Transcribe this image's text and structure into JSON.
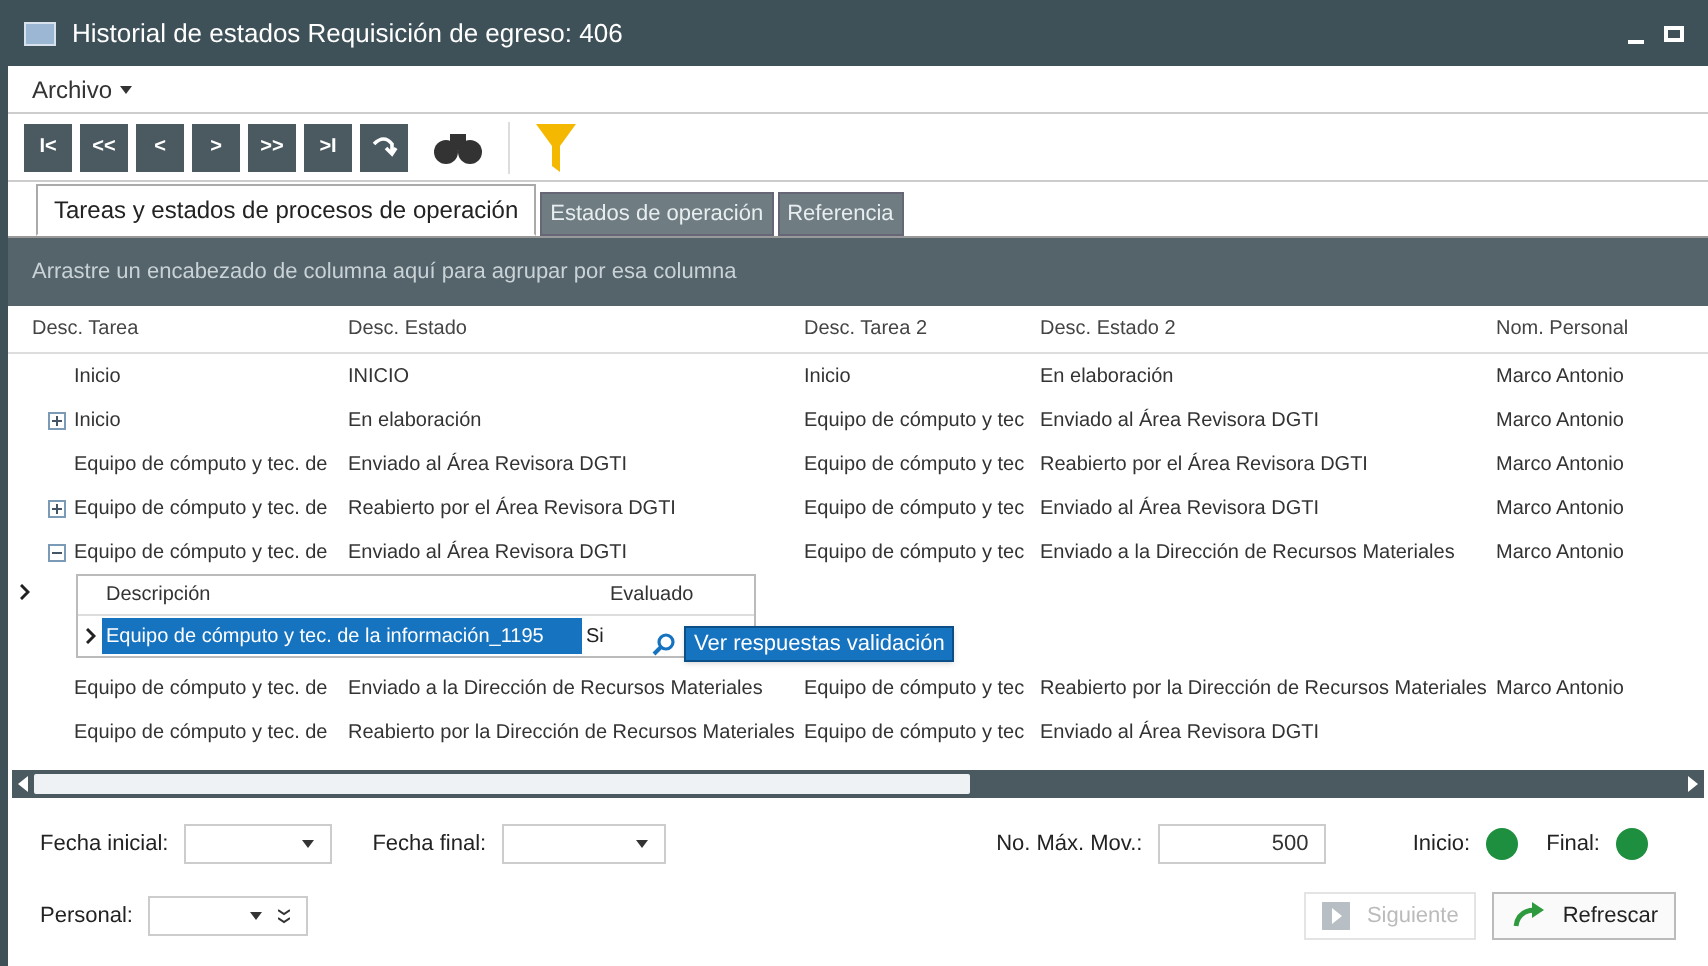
{
  "window": {
    "title": "Historial de estados Requisición de egreso: 406"
  },
  "menu": [
    {
      "label": "Archivo"
    }
  ],
  "toolbar": {
    "nav_buttons": [
      "I<",
      "<<",
      "<",
      ">",
      ">>",
      ">I"
    ]
  },
  "tabs": [
    {
      "label": "Tareas y estados de procesos de operación",
      "selected": true
    },
    {
      "label": "Estados de operación",
      "selected": false
    },
    {
      "label": "Referencia",
      "selected": false
    }
  ],
  "group_panel": {
    "hint": "Arrastre un encabezado de columna aquí para agrupar por esa columna"
  },
  "table": {
    "columns": [
      "Desc. Tarea",
      "Desc. Estado",
      "Desc. Tarea 2",
      "Desc. Estado 2",
      "Nom. Personal"
    ],
    "rows": [
      {
        "cells": [
          "Inicio",
          "INICIO",
          "Inicio",
          "En elaboración",
          "Marco Antonio"
        ]
      },
      {
        "expanded": false,
        "cells": [
          "Inicio",
          "En elaboración",
          "Equipo de cómputo y tec",
          "Enviado al Área Revisora DGTI",
          "Marco Antonio"
        ]
      },
      {
        "cells": [
          "Equipo de cómputo y tec. de",
          "Enviado al Área Revisora DGTI",
          "Equipo de cómputo y tec",
          "Reabierto por el Área Revisora DGTI",
          "Marco Antonio"
        ]
      },
      {
        "expanded": false,
        "cells": [
          "Equipo de cómputo y tec. de",
          "Reabierto por el Área Revisora DGTI",
          "Equipo de cómputo y tec",
          "Enviado al Área Revisora DGTI",
          "Marco Antonio"
        ]
      },
      {
        "expanded": true,
        "current": true,
        "cells": [
          "Equipo de cómputo y tec. de",
          "Enviado al Área Revisora DGTI",
          "Equipo de cómputo y tec",
          "Enviado a la Dirección de Recursos Materiales",
          "Marco Antonio"
        ],
        "detail": {
          "columns": [
            "Descripción",
            "Evaluado"
          ],
          "rows": [
            {
              "cells": [
                "Equipo de cómputo y tec. de la información_1195",
                "Si"
              ],
              "selected": true
            }
          ]
        }
      },
      {
        "cells": [
          "Equipo de cómputo y tec. de",
          "Enviado a la Dirección de Recursos Materiales",
          "Equipo de cómputo y tec",
          "Reabierto por la Dirección de Recursos Materiales",
          "Marco Antonio"
        ]
      },
      {
        "cells": [
          "Equipo de cómputo y tec. de",
          "Reabierto por la Dirección de Recursos Materiales",
          "Equipo de cómputo y tec",
          "Enviado al Área Revisora DGTI",
          ""
        ]
      }
    ]
  },
  "context_menu": {
    "items": [
      "Ver respuestas validación"
    ]
  },
  "filters": {
    "fecha_inicial": {
      "label": "Fecha inicial:"
    },
    "fecha_final": {
      "label": "Fecha final:"
    },
    "max_mov": {
      "label": "No. Máx. Mov.:",
      "value": "500"
    },
    "inicio": {
      "label": "Inicio:",
      "color": "#1e8f3e"
    },
    "final": {
      "label": "Final:",
      "color": "#1e8f3e"
    },
    "personal": {
      "label": "Personal:"
    }
  },
  "buttons": [
    {
      "label": "Siguiente",
      "disabled": true
    },
    {
      "label": "Refrescar",
      "disabled": false
    }
  ]
}
